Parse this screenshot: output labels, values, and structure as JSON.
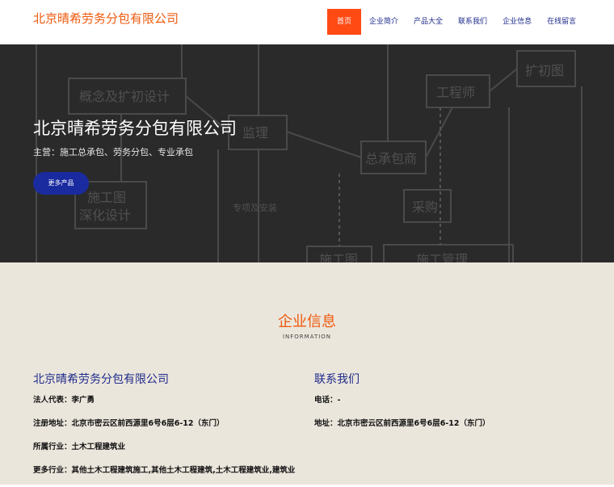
{
  "header": {
    "logo": "北京晴希劳务分包有限公司",
    "nav": [
      "首页",
      "企业简介",
      "产品大全",
      "联系我们",
      "企业信息",
      "在线留言"
    ]
  },
  "hero": {
    "title": "北京晴希劳务分包有限公司",
    "subtitle": "主营：施工总承包、劳务分包、专业承包",
    "button": "更多产品",
    "bg_text": [
      "概念及扩初设计",
      "施工图",
      "深化设计",
      "监理",
      "工程师",
      "总承包商",
      "采购",
      "施工图",
      "施工管理",
      "扩初图",
      "专项及安装"
    ]
  },
  "info": {
    "title": "企业信息",
    "subtitle": "INFORMATION",
    "left": {
      "title": "北京晴希劳务分包有限公司",
      "rows": [
        {
          "k": "法人代表：",
          "v": "李广勇"
        },
        {
          "k": "注册地址：",
          "v": "北京市密云区前西源里6号6层6-12（东门）"
        },
        {
          "k": "所属行业：",
          "v": "土木工程建筑业"
        },
        {
          "k": "更多行业：",
          "v": "其他土木工程建筑施工,其他土木工程建筑,土木工程建筑业,建筑业"
        }
      ]
    },
    "right": {
      "title": "联系我们",
      "rows": [
        {
          "k": "电话：",
          "v": "-"
        },
        {
          "k": "地址：",
          "v": "北京市密云区前西源里6号6层6-12（东门）"
        }
      ]
    }
  }
}
